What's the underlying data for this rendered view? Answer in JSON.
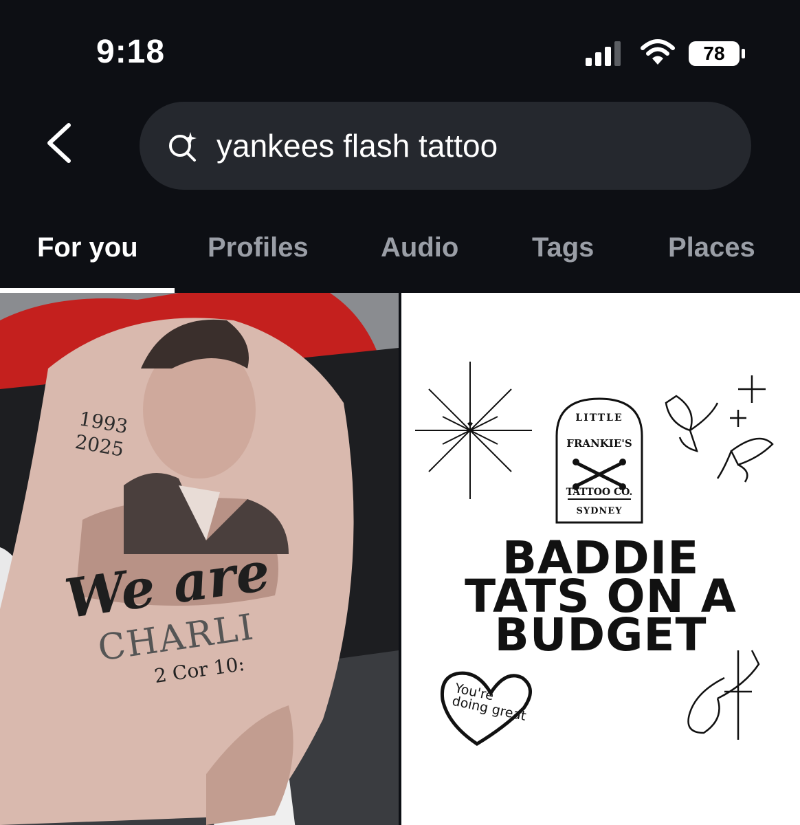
{
  "status_bar": {
    "time": "9:18",
    "battery": "78"
  },
  "search": {
    "query": "yankees flash tattoo"
  },
  "tabs": [
    {
      "label": "For you",
      "active": true
    },
    {
      "label": "Profiles",
      "active": false
    },
    {
      "label": "Audio",
      "active": false
    },
    {
      "label": "Tags",
      "active": false
    },
    {
      "label": "Places",
      "active": false
    }
  ],
  "results": {
    "left": {
      "years": "1993\n2025",
      "script": "We are",
      "name": "CHARLI",
      "verse": "2 Cor 10:"
    },
    "right": {
      "logo_line1": "LITTLE",
      "logo_line2": "FRANKIE'S",
      "logo_line3": "TATTOO CO.",
      "logo_line4": "SYDNEY",
      "headline": "BADDIE\nTATS ON A\nBUDGET",
      "heart_text": "You're doing great"
    }
  },
  "colors": {
    "background": "#0d0f14",
    "search_bg": "#25282e",
    "tab_inactive": "#9a9ea6",
    "tab_active": "#ffffff"
  }
}
